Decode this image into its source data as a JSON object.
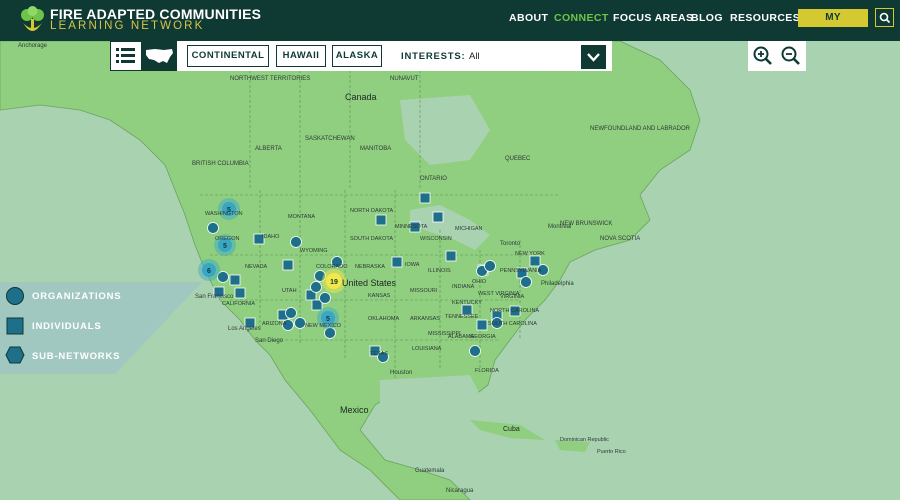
{
  "header": {
    "brand_title": "FIRE ADAPTED COMMUNITIES",
    "brand_subtitle": "LEARNING NETWORK",
    "nav": [
      {
        "label": "ABOUT",
        "active": false
      },
      {
        "label": "CONNECT",
        "active": true
      },
      {
        "label": "FOCUS AREAS",
        "active": false
      },
      {
        "label": "BLOG",
        "active": false
      },
      {
        "label": "RESOURCES",
        "active": false
      }
    ],
    "account_label": "MY ACCOUNT",
    "search_icon": "search-icon"
  },
  "toolbar": {
    "list_view_icon": "list-icon",
    "map_view_icon": "usa-map-icon",
    "regions": [
      "CONTINENTAL",
      "HAWAII",
      "ALASKA"
    ],
    "interests_label": "INTERESTS:",
    "interests_value": "All",
    "dropdown_icon": "chevron-down-icon"
  },
  "zoom": {
    "zoom_in_icon": "zoom-in-icon",
    "zoom_out_icon": "zoom-out-icon"
  },
  "legend": {
    "items": [
      {
        "label": "ORGANIZATIONS",
        "icon": "circle-icon"
      },
      {
        "label": "INDIVIDUALS",
        "icon": "square-icon"
      },
      {
        "label": "SUB-NETWORKS",
        "icon": "hexagon-icon"
      }
    ]
  },
  "map": {
    "country_labels": [
      "Canada",
      "United States",
      "Mexico",
      "Cuba"
    ],
    "province_labels": [
      "BRITISH COLUMBIA",
      "ALBERTA",
      "SASKATCHEWAN",
      "MANITOBA",
      "ONTARIO",
      "QUEBEC",
      "NEWFOUNDLAND AND LABRADOR",
      "NOVA SCOTIA",
      "NEW BRUNSWICK",
      "NORTHWEST TERRITORIES",
      "NUNAVUT"
    ],
    "state_labels": [
      "MONTANA",
      "NORTH DAKOTA",
      "SOUTH DAKOTA",
      "MINNESOTA",
      "WISCONSIN",
      "MICHIGAN",
      "IDAHO",
      "OREGON",
      "WASHINGTON",
      "WYOMING",
      "NEBRASKA",
      "IOWA",
      "NEVADA",
      "UTAH",
      "COLORADO",
      "KANSAS",
      "MISSOURI",
      "ILLINOIS",
      "INDIANA",
      "OHIO",
      "PENNSYLVANIA",
      "NEW YORK",
      "CALIFORNIA",
      "ARIZONA",
      "NEW MEXICO",
      "OKLAHOMA",
      "ARKANSAS",
      "TEXAS",
      "LOUISIANA",
      "MISSISSIPPI",
      "ALABAMA",
      "GEORGIA",
      "TENNESSEE",
      "KENTUCKY",
      "NORTH CAROLINA",
      "SOUTH CAROLINA",
      "VIRGINIA",
      "WEST VIRGINIA",
      "FLORIDA"
    ],
    "city_labels": [
      "Anchorage",
      "Toronto",
      "Montreal",
      "Philadelphia",
      "Houston",
      "San Diego",
      "Los Angeles",
      "San Francisco",
      "Dominican Republic",
      "Puerto Rico",
      "Guatemala",
      "Nicaragua"
    ],
    "cluster_counts": [
      "5",
      "5",
      "6",
      "19",
      "5"
    ],
    "colors": {
      "land": "#8fcf7f",
      "water": "#a9d2b0",
      "marker": "#1d6f8a",
      "cluster": "#3aa6c5",
      "cluster_hot": "#f2e84a"
    }
  }
}
